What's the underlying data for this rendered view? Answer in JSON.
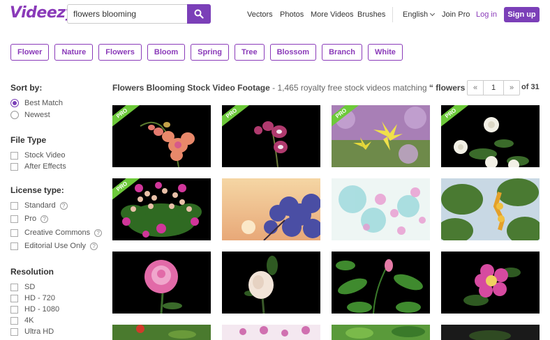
{
  "header": {
    "logo": "Videezy",
    "search_value": "flowers blooming",
    "nav": [
      "Vectors",
      "Photos",
      "More Videos",
      "Brushes"
    ],
    "language": "English",
    "join_pro": "Join Pro",
    "login": "Log in",
    "signup": "Sign up"
  },
  "tags": [
    "Flower",
    "Nature",
    "Flowers",
    "Bloom",
    "Spring",
    "Tree",
    "Blossom",
    "Branch",
    "White"
  ],
  "sidebar": {
    "sort_heading": "Sort by:",
    "sort_options": [
      "Best Match",
      "Newest"
    ],
    "sort_selected": "Best Match",
    "filetype_heading": "File Type",
    "filetype_options": [
      "Stock Video",
      "After Effects"
    ],
    "license_heading": "License type:",
    "license_options": [
      "Standard",
      "Pro",
      "Creative Commons",
      "Editorial Use Only"
    ],
    "help_mark": "?",
    "resolution_heading": "Resolution",
    "resolution_options": [
      "SD",
      "HD - 720",
      "HD - 1080",
      "4K",
      "Ultra HD"
    ]
  },
  "results": {
    "title_strong": "Flowers Blooming Stock Video Footage",
    "title_light": " - 1,465 royalty free stock videos matching ",
    "query_strong": "“ flowers blooming ”",
    "page": "1",
    "prev": "«",
    "next": "»",
    "of_pages": "of 31",
    "pro_label": "PRO"
  },
  "thumbnails": [
    {
      "name": "pink-orchid",
      "pro": true
    },
    {
      "name": "purple-orchid",
      "pro": true
    },
    {
      "name": "yellow-lilies",
      "pro": true
    },
    {
      "name": "white-roses",
      "pro": true
    },
    {
      "name": "kalanchoe-flowers",
      "pro": true
    },
    {
      "name": "lilac-sunset",
      "pro": false
    },
    {
      "name": "watercolor-blossoms",
      "pro": false
    },
    {
      "name": "leaves-yellow-flower",
      "pro": false
    },
    {
      "name": "pink-peony",
      "pro": false
    },
    {
      "name": "white-rose-bud",
      "pro": false
    },
    {
      "name": "rose-bud-leaves",
      "pro": false
    },
    {
      "name": "wild-rose",
      "pro": false
    },
    {
      "name": "red-flower-partial",
      "pro": false
    },
    {
      "name": "pink-flowers-partial",
      "pro": false
    },
    {
      "name": "green-leaves-partial",
      "pro": false
    },
    {
      "name": "dark-partial",
      "pro": false
    }
  ],
  "colors": {
    "brand": "#7b3fb8",
    "pro": "#6dc93a"
  }
}
